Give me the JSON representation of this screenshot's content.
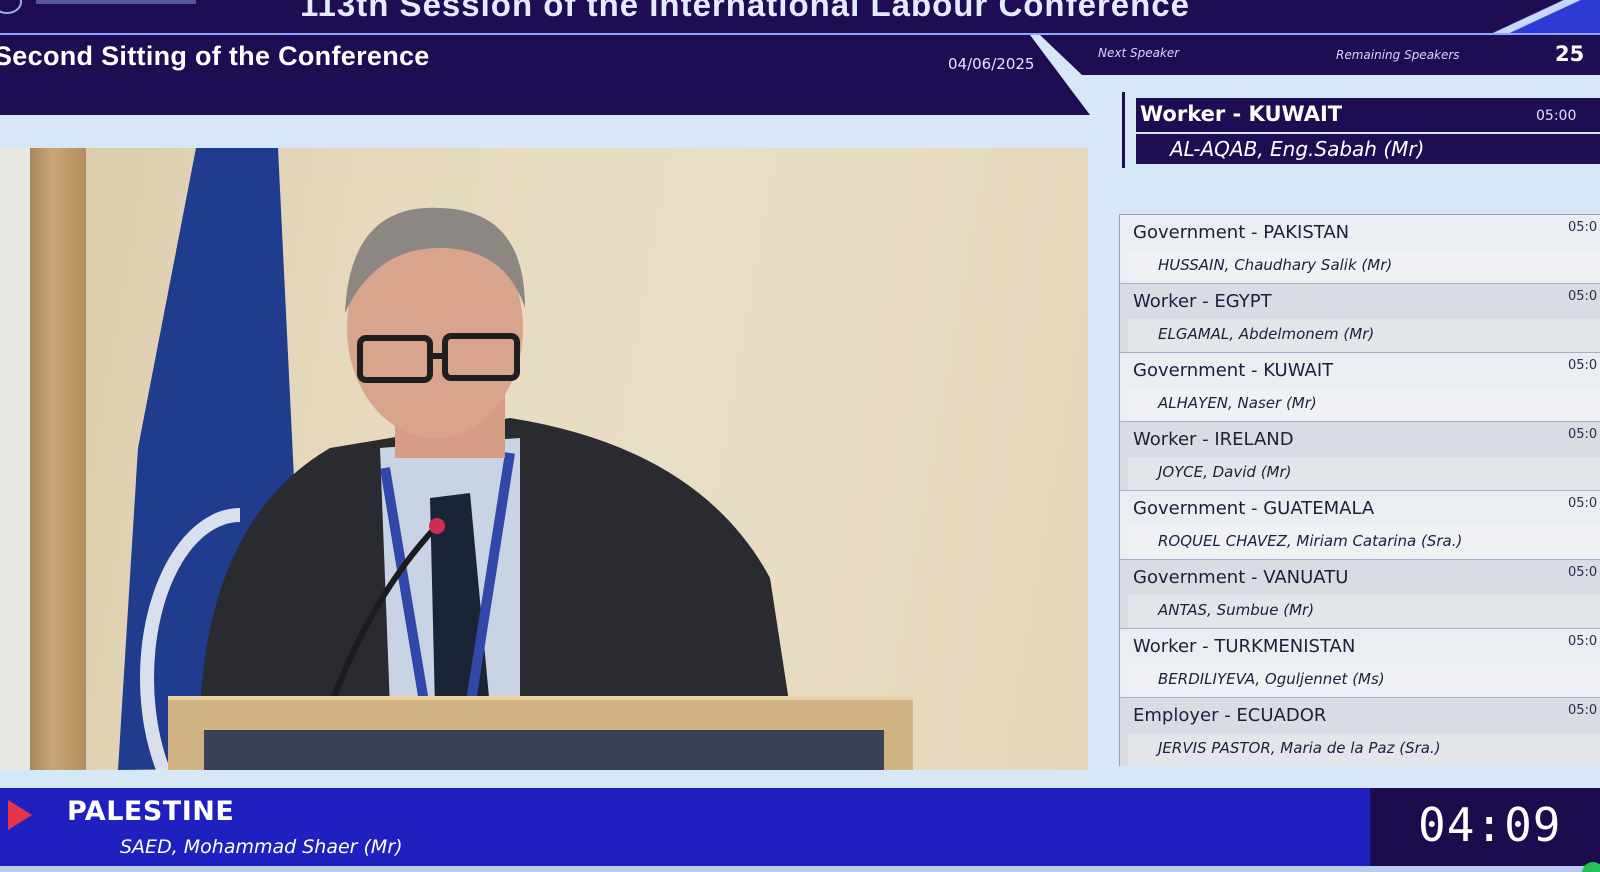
{
  "header": {
    "session_title": "113th Session of the International Labour Conference",
    "sitting_title": "Second Sitting of the Conference",
    "date": "04/06/2025"
  },
  "next_speaker_panel": {
    "next_label": "Next Speaker",
    "remaining_label": "Remaining Speakers",
    "remaining_count": "25",
    "delegation": "Worker - KUWAIT",
    "time": "05:00",
    "name": "AL-AQAB, Eng.Sabah (Mr)"
  },
  "speaker_list": [
    {
      "delegation": "Government - PAKISTAN",
      "name": "HUSSAIN, Chaudhary Salik (Mr)",
      "time": "05:0"
    },
    {
      "delegation": "Worker - EGYPT",
      "name": "ELGAMAL, Abdelmonem (Mr)",
      "time": "05:0"
    },
    {
      "delegation": "Government - KUWAIT",
      "name": "ALHAYEN, Naser (Mr)",
      "time": "05:0"
    },
    {
      "delegation": "Worker - IRELAND",
      "name": "JOYCE, David (Mr)",
      "time": "05:0"
    },
    {
      "delegation": "Government - GUATEMALA",
      "name": "ROQUEL CHAVEZ, Miriam Catarina (Sra.)",
      "time": "05:0"
    },
    {
      "delegation": "Government - VANUATU",
      "name": "ANTAS, Sumbue (Mr)",
      "time": "05:0"
    },
    {
      "delegation": "Worker - TURKMENISTAN",
      "name": "BERDILIYEVA, Oguljennet (Ms)",
      "time": "05:0"
    },
    {
      "delegation": "Employer - ECUADOR",
      "name": "JERVIS PASTOR, Maria de la Paz (Sra.)",
      "time": "05:0"
    }
  ],
  "current_speaker": {
    "delegation": "PALESTINE",
    "name": "SAED, Mohammad Shaer (Mr)",
    "timer": "04:09"
  },
  "colors": {
    "navy": "#1e0d52",
    "royal_blue": "#2020c0",
    "panel_bg": "#d6e8f7",
    "play_red": "#e8344a"
  },
  "icons": {
    "play": "play-icon",
    "logo": "ilo-logo-icon"
  }
}
